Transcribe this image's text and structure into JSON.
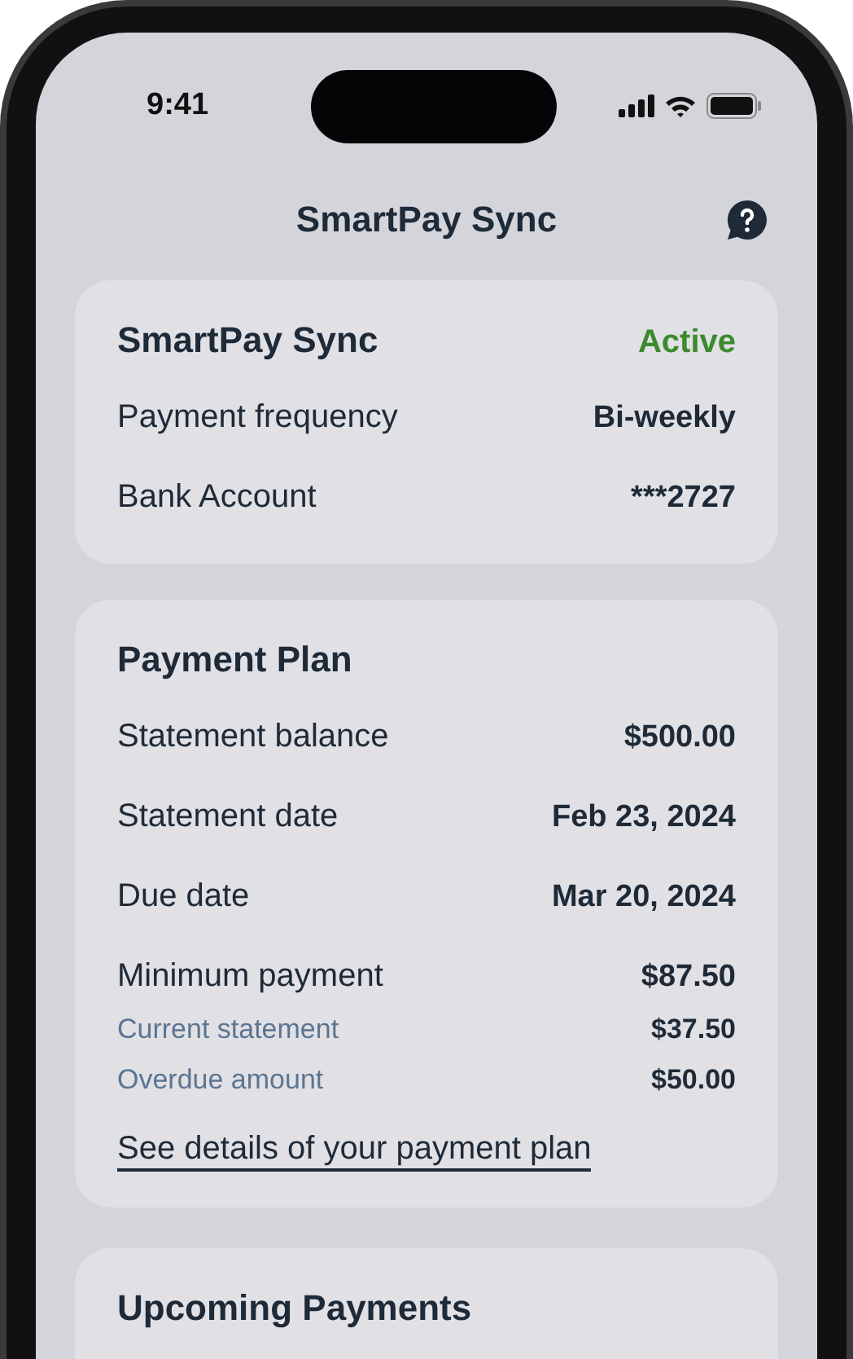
{
  "status_bar": {
    "time": "9:41"
  },
  "header": {
    "title": "SmartPay Sync"
  },
  "sync_card": {
    "title": "SmartPay Sync",
    "status": "Active",
    "rows": [
      {
        "label": "Payment frequency",
        "value": "Bi-weekly"
      },
      {
        "label": "Bank Account",
        "value": "***2727"
      }
    ]
  },
  "plan_card": {
    "title": "Payment Plan",
    "rows": [
      {
        "kind": "main",
        "label": "Statement balance",
        "value": "$500.00"
      },
      {
        "kind": "main",
        "label": "Statement date",
        "value": "Feb 23, 2024"
      },
      {
        "kind": "main",
        "label": "Due date",
        "value": "Mar 20, 2024"
      },
      {
        "kind": "main",
        "label": "Minimum payment",
        "value": "$87.50"
      },
      {
        "kind": "sub",
        "label": "Current statement",
        "value": "$37.50"
      },
      {
        "kind": "sub",
        "label": "Overdue amount",
        "value": "$50.00"
      }
    ],
    "link": "See details of your payment plan"
  },
  "upcoming_card": {
    "title": "Upcoming Payments"
  }
}
